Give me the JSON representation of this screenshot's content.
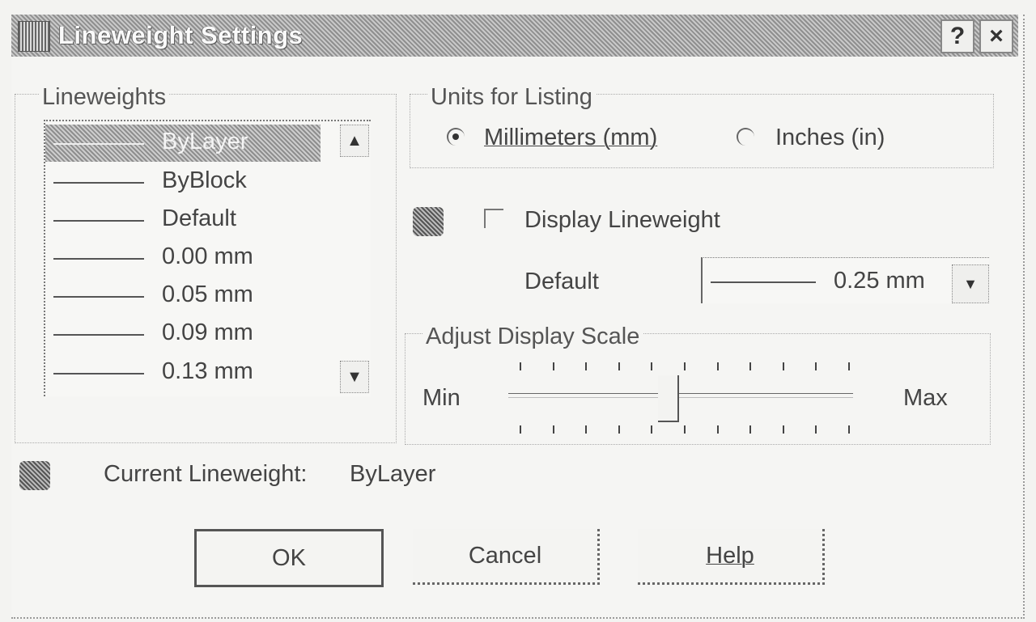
{
  "window": {
    "title": "Lineweight Settings",
    "help_glyph": "?",
    "close_glyph": "×"
  },
  "lineweights": {
    "label": "Lineweights",
    "selected_item": "ByLayer",
    "items": [
      "ByLayer",
      "ByBlock",
      "Default",
      "0.00 mm",
      "0.05 mm",
      "0.09 mm",
      "0.13 mm"
    ]
  },
  "units": {
    "label": "Units for Listing",
    "options": [
      {
        "label": "Millimeters (mm)",
        "selected": true
      },
      {
        "label": "Inches (in)",
        "selected": false
      }
    ]
  },
  "display_lineweight": {
    "label": "Display Lineweight",
    "checked": false
  },
  "default_setting": {
    "label": "Default",
    "value": "0.25 mm"
  },
  "display_scale": {
    "label": "Adjust Display Scale",
    "min_label": "Min",
    "max_label": "Max",
    "position": 0.45
  },
  "current": {
    "label": "Current Lineweight:",
    "value": "ByLayer"
  },
  "buttons": {
    "ok": "OK",
    "cancel": "Cancel",
    "help": "Help"
  },
  "icons": {
    "window": "app-icon",
    "display_lineweight": "lineweight-icon",
    "current": "lineweight-icon",
    "scroll_up": "arrow-up-icon",
    "scroll_down": "arrow-down-icon",
    "combo": "chevron-down-icon"
  }
}
